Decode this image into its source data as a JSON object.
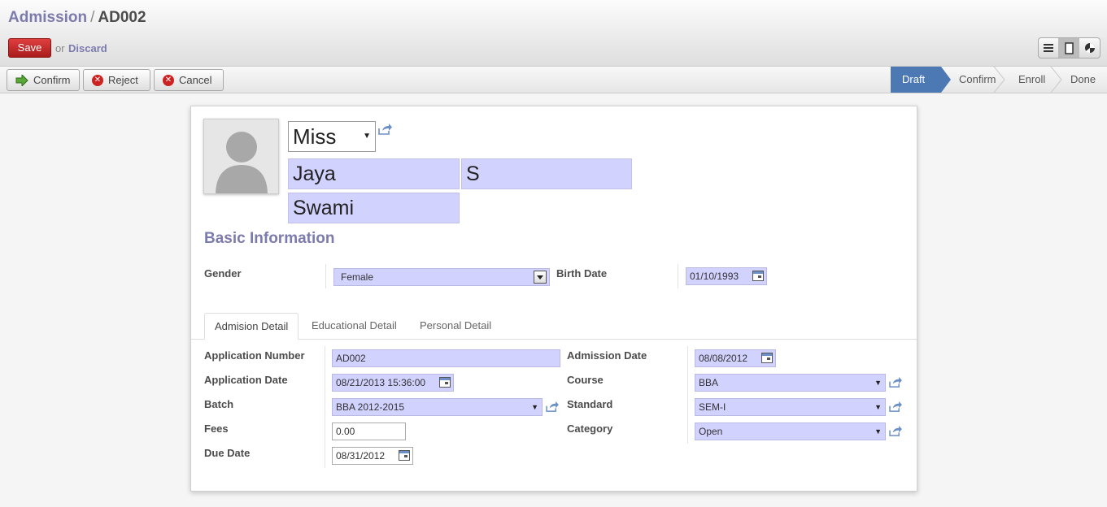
{
  "breadcrumb": {
    "parent": "Admission",
    "separator": "/",
    "current": "AD002"
  },
  "buttons": {
    "save": "Save",
    "or": "or",
    "discard": "Discard"
  },
  "view_switch": [
    "list-icon",
    "form-icon",
    "pie-icon"
  ],
  "actions": {
    "confirm": "Confirm",
    "reject": "Reject",
    "cancel": "Cancel"
  },
  "stages": [
    "Draft",
    "Confirm",
    "Enroll",
    "Done"
  ],
  "active_stage": "Draft",
  "record": {
    "title": "Miss",
    "first_name": "Jaya",
    "middle_name": "S",
    "last_name": "Swami"
  },
  "basic_info": {
    "section_title": "Basic Information",
    "gender_label": "Gender",
    "gender_value": "Female",
    "birth_date_label": "Birth Date",
    "birth_date_value": "01/10/1993"
  },
  "tabs": [
    "Admision Detail",
    "Educational Detail",
    "Personal Detail"
  ],
  "admission_detail": {
    "application_number_label": "Application Number",
    "application_number_value": "AD002",
    "application_date_label": "Application Date",
    "application_date_value": "08/21/2013 15:36:00",
    "batch_label": "Batch",
    "batch_value": "BBA 2012-2015",
    "fees_label": "Fees",
    "fees_value": "0.00",
    "due_date_label": "Due Date",
    "due_date_value": "08/31/2012",
    "admission_date_label": "Admission Date",
    "admission_date_value": "08/08/2012",
    "course_label": "Course",
    "course_value": "BBA",
    "standard_label": "Standard",
    "standard_value": "SEM-I",
    "category_label": "Category",
    "category_value": "Open"
  },
  "colors": {
    "accent": "#7c7bad",
    "required_field": "#d2d2ff",
    "save": "#c62828",
    "active_stage": "#4c79b4"
  }
}
